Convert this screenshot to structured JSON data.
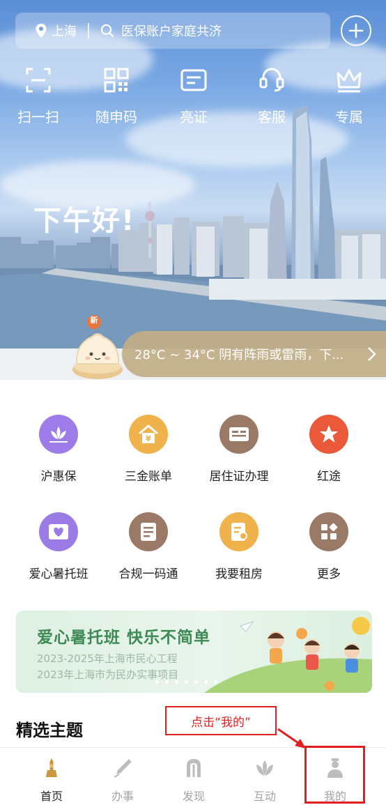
{
  "header": {
    "location": "上海",
    "search_placeholder": "医保账户家庭共济"
  },
  "quick_actions": [
    {
      "label": "扫一扫",
      "icon": "scan-icon"
    },
    {
      "label": "随申码",
      "icon": "qr-code-icon"
    },
    {
      "label": "亮证",
      "icon": "id-card-icon"
    },
    {
      "label": "客服",
      "icon": "customer-service-icon"
    },
    {
      "label": "专属",
      "icon": "crown-icon"
    }
  ],
  "greeting": "下午好!",
  "weather": {
    "badge": "新",
    "text": "28°C ~ 34°C  阴有阵雨或雷雨，下..."
  },
  "services": [
    {
      "label": "沪惠保",
      "icon": "lotus-icon",
      "color": "#9d7be8"
    },
    {
      "label": "三金账单",
      "icon": "house-yuan-icon",
      "color": "#f0b24a"
    },
    {
      "label": "居住证办理",
      "icon": "residence-card-icon",
      "color": "#9a7a66"
    },
    {
      "label": "红途",
      "icon": "red-star-icon",
      "color": "#ea5a3a"
    },
    {
      "label": "爱心暑托班",
      "icon": "heart-card-icon",
      "color": "#9b7be6"
    },
    {
      "label": "合规一码通",
      "icon": "checklist-icon",
      "color": "#9a7a66"
    },
    {
      "label": "我要租房",
      "icon": "rent-document-icon",
      "color": "#f0b24a"
    },
    {
      "label": "更多",
      "icon": "more-apps-icon",
      "color": "#9a7a66"
    }
  ],
  "banner": {
    "title": "爱心暑托班  快乐不简单",
    "line1": "2023-2025年上海市民心工程",
    "line2": "2023年上海市为民办实事项目"
  },
  "section_title": "精选主题",
  "annotation": "点击“我的”",
  "bottom_nav": [
    {
      "label": "首页",
      "icon": "home-icon",
      "active": true
    },
    {
      "label": "办事",
      "icon": "pen-icon",
      "active": false
    },
    {
      "label": "发现",
      "icon": "discover-icon",
      "active": false
    },
    {
      "label": "互动",
      "icon": "interact-icon",
      "active": false
    },
    {
      "label": "我的",
      "icon": "profile-icon",
      "active": false
    }
  ]
}
